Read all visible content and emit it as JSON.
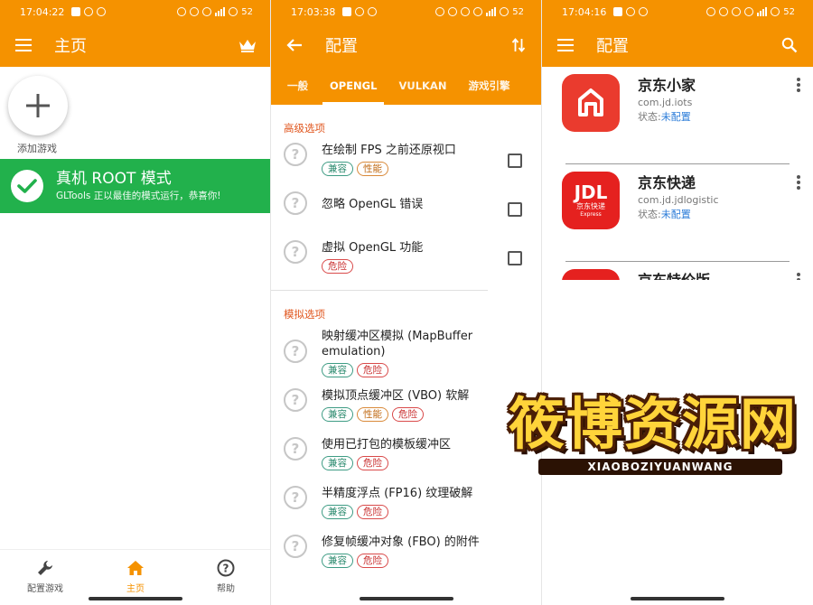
{
  "colors": {
    "accent": "#f59200",
    "success": "#22b14c",
    "section_header": "#e0561e",
    "status_link": "#2a7bd8",
    "badge_compat": "#2b8a6e",
    "badge_perf": "#c06a14",
    "badge_danger": "#c93030"
  },
  "panel1": {
    "status": {
      "time": "17:04:22",
      "battery": "52"
    },
    "appbar": {
      "title": "主页",
      "menu_icon": "menu-icon",
      "action_icon": "crown-icon"
    },
    "add_game_label": "添加游戏",
    "root_banner": {
      "title": "真机 ROOT 模式",
      "subtitle": "GLTools 正以最佳的模式运行，恭喜你!"
    },
    "bottom_nav": [
      {
        "label": "配置游戏",
        "icon": "wrench-icon",
        "active": false
      },
      {
        "label": "主页",
        "icon": "home-icon",
        "active": true
      },
      {
        "label": "帮助",
        "icon": "help-icon",
        "active": false
      }
    ]
  },
  "panel2": {
    "status": {
      "time": "17:03:38",
      "battery": "52"
    },
    "appbar": {
      "title": "配置",
      "back_icon": "back-arrow-icon",
      "action_icon": "sort-icon"
    },
    "tabs": [
      "一般",
      "OPENGL",
      "VULKAN",
      "游戏引擎"
    ],
    "active_tab": "OPENGL",
    "sections": [
      {
        "title": "高级选项",
        "options": [
          {
            "title": "在绘制 FPS 之前还原视口",
            "badges": [
              "兼容",
              "性能"
            ],
            "checked": false
          },
          {
            "title": "忽略 OpenGL 错误",
            "badges": [],
            "checked": false
          },
          {
            "title": "虚拟 OpenGL 功能",
            "badges": [
              "危险"
            ],
            "checked": false
          }
        ]
      },
      {
        "title": "模拟选项",
        "options": [
          {
            "title": "映射缓冲区模拟 (MapBuffer emulation)",
            "badges": [
              "兼容",
              "危险"
            ]
          },
          {
            "title": "模拟顶点缓冲区 (VBO) 软解",
            "badges": [
              "兼容",
              "性能",
              "危险"
            ]
          },
          {
            "title": "使用已打包的模板缓冲区",
            "badges": [
              "兼容",
              "危险"
            ]
          },
          {
            "title": "半精度浮点 (FP16) 纹理破解",
            "badges": [
              "兼容",
              "危险"
            ]
          },
          {
            "title": "修复帧缓冲对象 (FBO) 的附件",
            "badges": [
              "兼容",
              "危险"
            ]
          }
        ]
      }
    ]
  },
  "panel3": {
    "status": {
      "time": "17:04:16",
      "battery": "52"
    },
    "appbar": {
      "title": "配置",
      "menu_icon": "menu-icon",
      "action_icon": "search-icon"
    },
    "apps": [
      {
        "name": "京东小家",
        "package": "com.jd.iots",
        "status_label": "状态:",
        "status_value": "未配置",
        "icon": "jd-home-app-icon"
      },
      {
        "name": "京东快递",
        "package": "com.jd.jdlogistic",
        "status_label": "状态:",
        "status_value": "未配置",
        "icon": "jd-express-app-icon",
        "icon_text": "JDL",
        "icon_subtext": "京东快递",
        "icon_caption": "Express"
      },
      {
        "name": "京东特价版",
        "icon": "jd-lite-app-icon"
      }
    ]
  },
  "watermark": {
    "title": "筱博资源网",
    "subtitle": "XIAOBOZIYUANWANG"
  }
}
